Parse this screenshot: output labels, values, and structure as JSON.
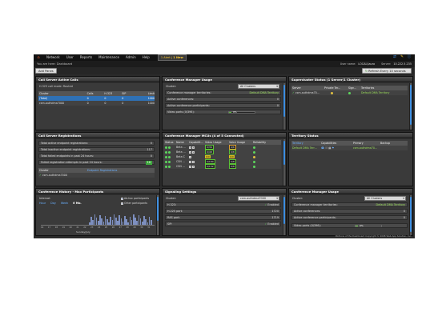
{
  "nav": {
    "items": [
      "Network",
      "User",
      "Reports",
      "Maintenance",
      "Admin",
      "Help"
    ],
    "alert_label": "1 Alert",
    "alert_new": "1 New"
  },
  "subbar": {
    "breadcrumb": "You are here:   Dashboard",
    "user_label": "User name:",
    "user_value": "LOCAL\\laura",
    "server_label": "Server:",
    "server_value": "10.222.5.235"
  },
  "toolbar": {
    "add_panes": "Add Panes",
    "refresh": "Refresh Every 10 seconds"
  },
  "panels": {
    "active_calls": {
      "title": "Call Server Active Calls",
      "mode": "H.323 call mode:   Routed",
      "headers": [
        "Cluster",
        "Calls",
        "H.323",
        "SIP",
        "Limit"
      ],
      "rows": [
        {
          "cluster": "(Total)",
          "calls": "0",
          "h323": "0",
          "sip": "0",
          "limit": "1000"
        },
        {
          "cluster": "csm-authdma7000",
          "calls": "0",
          "h323": "0",
          "sip": "0",
          "limit": "1000"
        }
      ]
    },
    "conf_usage_1": {
      "title": "Conference Manager Usage",
      "cluster_label": "Cluster:",
      "cluster_value": "All Clusters",
      "territories_label": "Conference manager territories:",
      "territories_value": "Default DMA Territory",
      "active_label": "Active conferences:",
      "active_value": "0",
      "participants_label": "Active conference participants:",
      "participants_value": "0",
      "video_label": "Video ports (0/396):",
      "video_pct": "0%"
    },
    "supercluster": {
      "title": "Supercluster Status (1 Server/1 Cluster)",
      "headers": [
        "Server",
        "Private Ter...",
        "Sign...",
        "Territories"
      ],
      "rows": [
        {
          "server": "csm-authdma70...",
          "territories": "Default DMA Territory"
        }
      ]
    },
    "registrations": {
      "title": "Call Server Registrations",
      "rows": [
        {
          "label": "Total active endpoint registrations:",
          "value": "0"
        },
        {
          "label": "Total inactive endpoint registrations:",
          "value": "117"
        },
        {
          "label": "Total failed endpoints in past 24 hours:",
          "value": "0"
        },
        {
          "label": "Failed registration attempts in past 24 hours:",
          "value": "16"
        }
      ],
      "headers": [
        "Cluster",
        "Endpoint Registrations"
      ],
      "cluster": "csm-authdma7000"
    },
    "mcus": {
      "title": "Conference Manager MCUs (4 of 5 Connected)",
      "headers": [
        "Status",
        "Name",
        "Capabilit...",
        "Video Usage",
        "Voice Usage",
        "Reliability"
      ],
      "rows": [
        {
          "name": "Beta ...",
          "video": "0/36",
          "voice": "4/6"
        },
        {
          "name": "Beta ...",
          "video": "0/48",
          "voice": "0/8"
        },
        {
          "name": "Beta C",
          "video": "0/0",
          "voice": "0/0"
        },
        {
          "name": "CSN ...",
          "video": "0/180",
          "voice": "0/8"
        },
        {
          "name": "CSN ...",
          "video": "0/132",
          "voice": "0/8"
        }
      ]
    },
    "territory": {
      "title": "Territory Status",
      "headers": [
        "Territory",
        "Capabilities",
        "Primary",
        "Backup"
      ],
      "rows": [
        {
          "territory": "Default DMA Terr...",
          "primary": "csm-authdma70..."
        }
      ]
    },
    "history": {
      "title": "Conference History - Max Participants",
      "interval_label": "Interval:",
      "intervals": [
        "Hour",
        "Day",
        "Week",
        "6 Mo."
      ],
      "legend_adhoc": "Ad-hoc participants",
      "legend_other": "Other participants",
      "x_labels": [
        "16",
        "17",
        "18",
        "19",
        "20",
        "21",
        "22",
        "23",
        "24",
        "25",
        "26",
        "27",
        "28",
        "29",
        "30",
        "31"
      ],
      "x_title": "Sunday/July"
    },
    "signaling": {
      "title": "Signaling Settings",
      "cluster_label": "Cluster:",
      "cluster_value": "csm-authdma7000",
      "rows": [
        {
          "label": "H.323:",
          "value": "Enabled"
        },
        {
          "label": "H.225 port:",
          "value": "1720"
        },
        {
          "label": "RAS port:",
          "value": "1719"
        },
        {
          "label": "SIP:",
          "value": "Enabled"
        }
      ]
    },
    "conf_usage_2": {
      "title": "Conference Manager Usage",
      "cluster_label": "Cluster:",
      "cluster_value": "All Clusters",
      "territories_label": "Conference manager territories:",
      "territories_value": "Default DMA Territory",
      "active_label": "Active conferences:",
      "active_value": "0",
      "participants_label": "Active conference participants:",
      "participants_value": "0",
      "video_label": "Video ports (0/396):",
      "video_pct": "0%"
    }
  },
  "footer": "Portions of the Dashboard Copyright © 2008 Web App Solution, Inc.",
  "colors": {
    "accent": "#3d8ee0",
    "ok": "#5cd65c",
    "alert": "#ffcc33"
  }
}
